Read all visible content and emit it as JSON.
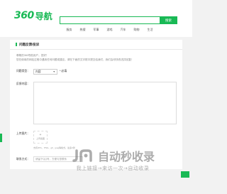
{
  "header": {
    "logo_number": "360",
    "logo_text": "导航",
    "search_placeholder": "",
    "search_button": "搜索",
    "nav": [
      "服务",
      "热搜",
      "军事",
      "游戏",
      "汽车",
      "购物",
      "生活"
    ]
  },
  "form": {
    "title": "问题反馈/投诉",
    "intro_line1": "尊敬的360导航用户，您好！",
    "intro_line2": "您在使用的网站过程中遇到任何问题或建议，请在下面的文字框中提交给我们，我们会尽快改进并回复！",
    "type_label": "问题类型：",
    "type_value": "内容",
    "type_required": "* 必填",
    "content_label": "反馈内容：",
    "upload_label": "上传图片：",
    "upload_button": "上传截图",
    "upload_hint": "支持JPG、PNG、gif、jpeg等格式，最多3张",
    "contact_label": "联系方式：",
    "contact_placeholder": "请留下QQ号，方便与您联系"
  },
  "watermark": {
    "title": "自动秒收录",
    "subtitle": "我上链接→来访一次→自动收录"
  },
  "colors": {
    "accent": "#19b955",
    "background": "#f2f2f2"
  }
}
